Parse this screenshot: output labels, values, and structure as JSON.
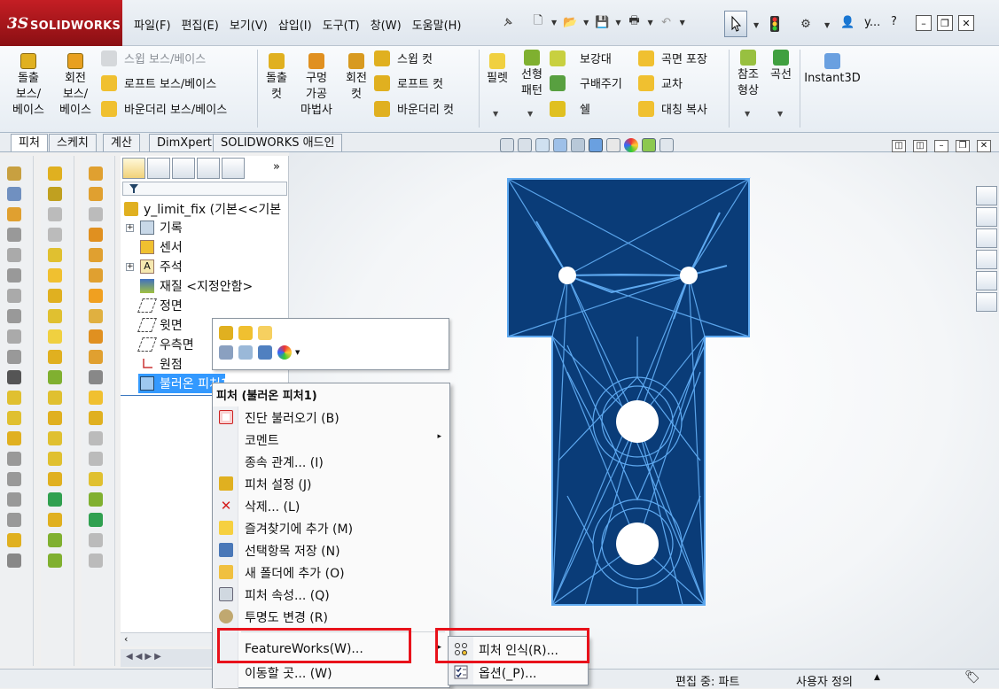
{
  "app": {
    "brand_ds": "3S",
    "brand_name": "SOLIDWORKS"
  },
  "menubar": [
    "파일(F)",
    "편집(E)",
    "보기(V)",
    "삽입(I)",
    "도구(T)",
    "창(W)",
    "도움말(H)"
  ],
  "user_menu": "y...",
  "ribbon": {
    "extrude_boss": [
      "돌출",
      "보스/",
      "베이스"
    ],
    "revolve_boss": [
      "회전",
      "보스/",
      "베이스"
    ],
    "sweep_boss": "스윕 보스/베이스",
    "loft_boss": "로프트 보스/베이스",
    "boundary_boss": "바운더리 보스/베이스",
    "extrude_cut": [
      "돌출",
      "컷"
    ],
    "hole_wizard": [
      "구멍",
      "가공",
      "마법사"
    ],
    "revolve_cut": [
      "회전",
      "컷"
    ],
    "sweep_cut": "스윕 컷",
    "loft_cut": "로프트 컷",
    "boundary_cut": "바운더리 컷",
    "fillet": "필렛",
    "linear_pattern": [
      "선형",
      "패턴"
    ],
    "rib": "보강대",
    "draft": "구배주기",
    "shell": "쉘",
    "wrap": "곡면 포장",
    "intersect": "교차",
    "mirror": "대칭 복사",
    "ref_geometry": [
      "참조",
      "형상"
    ],
    "curves": "곡선",
    "instant3d": "Instant3D"
  },
  "cm_tabs": [
    "피처",
    "스케치",
    "계산",
    "DimXpert",
    "SOLIDWORKS 애드인"
  ],
  "tree": {
    "root": "y_limit_fix  (기본<<기본",
    "items": [
      "기록",
      "센서",
      "주석",
      "재질 <지정안함>",
      "정면",
      "윗면",
      "우측면",
      "원점",
      "불러온 피처1"
    ]
  },
  "context_menu": {
    "title": "피처 (불러온 피처1)",
    "items": [
      {
        "label": "진단 불러오기 (B)",
        "icon": "diagnosis-icon"
      },
      {
        "label": "코멘트",
        "icon": "",
        "submenu": true
      },
      {
        "label": "종속 관계... (I)",
        "icon": ""
      },
      {
        "label": "피처 설정 (J)",
        "icon": "feature-settings-icon"
      },
      {
        "label": "삭제... (L)",
        "icon": "delete-icon"
      },
      {
        "label": "즐겨찾기에 추가 (M)",
        "icon": "favorite-icon"
      },
      {
        "label": "선택항목 저장 (N)",
        "icon": "save-selection-icon"
      },
      {
        "label": "새 폴더에 추가 (O)",
        "icon": "folder-icon"
      },
      {
        "label": "피처 속성... (Q)",
        "icon": "properties-icon"
      },
      {
        "label": "투명도 변경 (R)",
        "icon": "transparency-icon"
      },
      {
        "label": "FeatureWorks(W)...",
        "icon": "",
        "submenu": true
      },
      {
        "label": "이동할 곳... (W)",
        "icon": ""
      }
    ]
  },
  "submenu": [
    {
      "label": "피처 인식(R)...",
      "icon": "feature-recognition-icon"
    },
    {
      "label": "옵션(_P)...",
      "icon": "options-icon"
    }
  ],
  "statusbar": {
    "mode": "편집 중: 파트",
    "units": "사용자 정의"
  },
  "colors": {
    "part_fill": "#0a3c78",
    "part_lines": "#5ea9f0",
    "highlight_box": "#e8121b",
    "selection": "#3399ff"
  }
}
